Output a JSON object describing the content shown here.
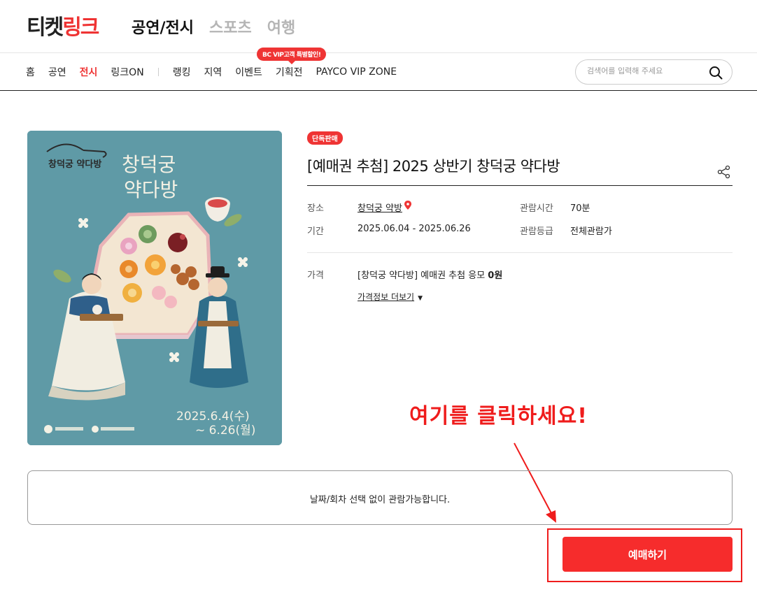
{
  "header": {
    "logo_main": "티켓",
    "logo_accent": "링크",
    "category_tabs": [
      {
        "label": "공연/전시",
        "active": true
      },
      {
        "label": "스포츠",
        "active": false
      },
      {
        "label": "여행",
        "active": false
      }
    ]
  },
  "nav": {
    "items": [
      "홈",
      "공연",
      "전시",
      "링크ON"
    ],
    "items2": [
      "랭킹",
      "지역",
      "이벤트",
      "기획전",
      "PAYCO VIP ZONE"
    ],
    "promo_badge": "BC VIP고객 특별할인!",
    "search_placeholder": "검색어를 입력해 주세요"
  },
  "poster": {
    "title_line1": "창덕궁",
    "title_line2": "약다방",
    "logo_text": "창덕궁 약다방",
    "date_line1": "2025.6.4(수)",
    "date_line2": "~ 6.26(월)"
  },
  "product": {
    "badge": "단독판매",
    "title": "[예매권 추첨] 2025 상반기 창덕궁 약다방",
    "venue_label": "장소",
    "venue_value": "창덕궁 약방",
    "period_label": "기간",
    "period_value": "2025.06.04 - 2025.06.26",
    "runtime_label": "관람시간",
    "runtime_value": "70분",
    "rating_label": "관람등급",
    "rating_value": "전체관람가",
    "price_label": "가격",
    "price_desc": "[창덕궁 약다방] 예매권 추첨 응모",
    "price_amount": "0원",
    "more_price": "가격정보 더보기"
  },
  "annotation": "여기를 클릭하세요!",
  "notice": "날짜/회차 선택 없이 관람가능합니다.",
  "book_button": "예매하기",
  "colors": {
    "accent": "#ef3434",
    "poster_bg": "#5f9aa6"
  }
}
